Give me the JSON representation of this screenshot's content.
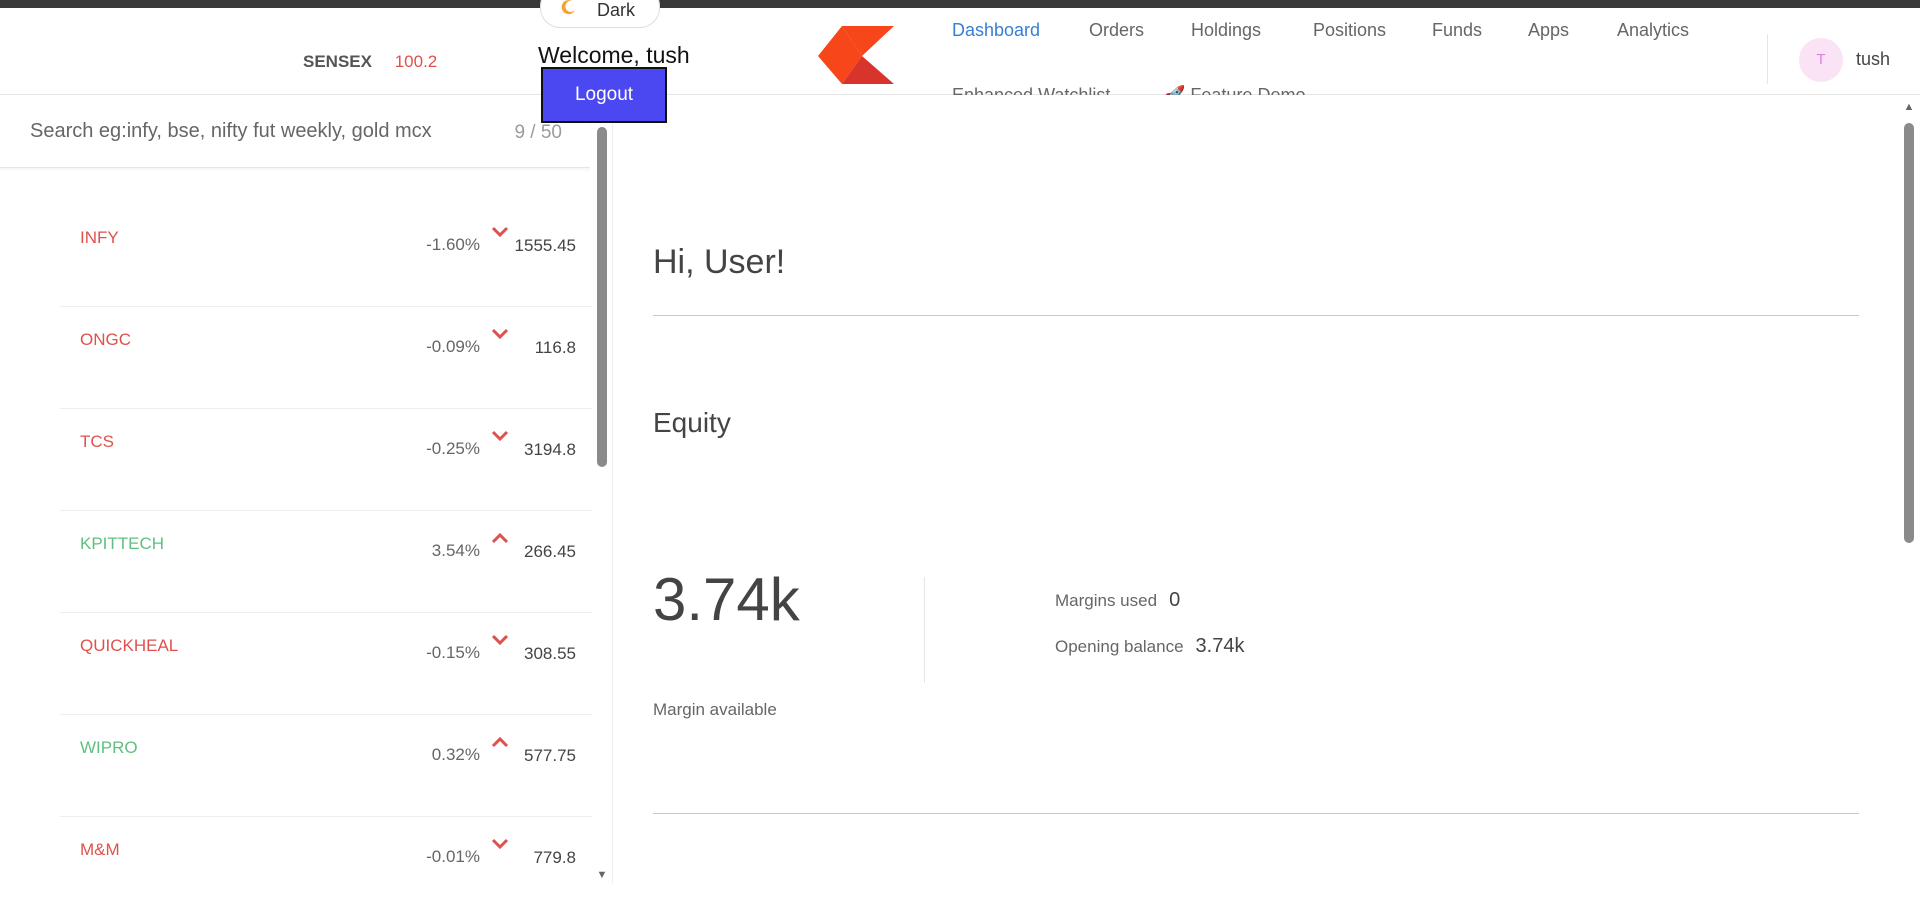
{
  "header": {
    "index": {
      "name": "SENSEX",
      "value": "100.2"
    },
    "theme_label": "Dark",
    "welcome": "Welcome, tush",
    "logout_label": "Logout",
    "nav": [
      {
        "label": "Dashboard",
        "active": true
      },
      {
        "label": "Orders"
      },
      {
        "label": "Holdings"
      },
      {
        "label": "Positions"
      },
      {
        "label": "Funds"
      },
      {
        "label": "Apps"
      },
      {
        "label": "Analytics"
      },
      {
        "label": "Enhanced Watchlist"
      },
      {
        "label": "🚀 Feature Demo"
      }
    ],
    "avatar_initial": "T",
    "username": "tush"
  },
  "watchlist": {
    "search_placeholder": "Search eg:infy, bse, nifty fut weekly, gold mcx",
    "count": "9 / 50",
    "items": [
      {
        "symbol": "INFY",
        "change": "-1.60%",
        "direction": "down",
        "price": "1555.45"
      },
      {
        "symbol": "ONGC",
        "change": "-0.09%",
        "direction": "down",
        "price": "116.8"
      },
      {
        "symbol": "TCS",
        "change": "-0.25%",
        "direction": "down",
        "price": "3194.8"
      },
      {
        "symbol": "KPITTECH",
        "change": "3.54%",
        "direction": "up",
        "price": "266.45"
      },
      {
        "symbol": "QUICKHEAL",
        "change": "-0.15%",
        "direction": "down",
        "price": "308.55"
      },
      {
        "symbol": "WIPRO",
        "change": "0.32%",
        "direction": "up",
        "price": "577.75"
      },
      {
        "symbol": "M&M",
        "change": "-0.01%",
        "direction": "down",
        "price": "779.8"
      }
    ]
  },
  "dashboard": {
    "greeting": "Hi, User!",
    "section_title": "Equity",
    "margin_available_value": "3.74k",
    "margin_available_label": "Margin available",
    "margins_used_label": "Margins used",
    "margins_used_value": "0",
    "opening_balance_label": "Opening balance",
    "opening_balance_value": "3.74k"
  },
  "colors": {
    "accent": "#387ed1",
    "down": "#df514c",
    "up": "#4caf50",
    "logout": "#4b48f1"
  }
}
